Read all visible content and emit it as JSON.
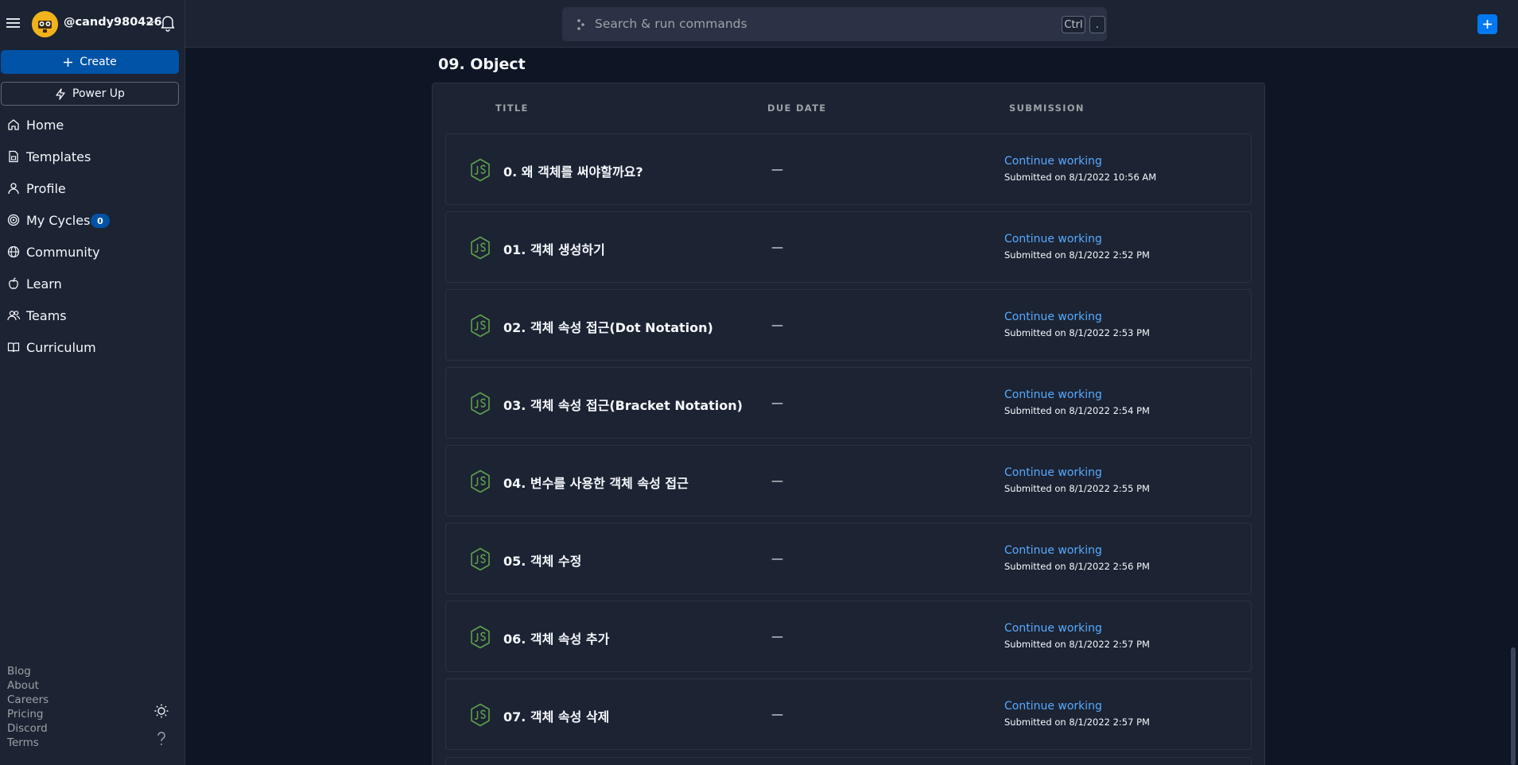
{
  "user": {
    "handle": "@candy980426"
  },
  "sidebar": {
    "create_label": "Create",
    "power_up_label": "Power Up",
    "nav": [
      {
        "label": "Home",
        "icon": "home-icon"
      },
      {
        "label": "Templates",
        "icon": "templates-icon"
      },
      {
        "label": "Profile",
        "icon": "profile-icon"
      },
      {
        "label": "My Cycles",
        "icon": "cycles-icon",
        "badge": "0"
      },
      {
        "label": "Community",
        "icon": "globe-icon"
      },
      {
        "label": "Learn",
        "icon": "learn-icon"
      },
      {
        "label": "Teams",
        "icon": "teams-icon"
      },
      {
        "label": "Curriculum",
        "icon": "book-icon"
      }
    ],
    "footer_links": [
      "Blog",
      "About",
      "Careers",
      "Pricing",
      "Discord",
      "Terms"
    ]
  },
  "topbar": {
    "search_placeholder": "Search & run commands",
    "shortcut_key1": "Ctrl",
    "shortcut_key2": "."
  },
  "section": {
    "title": "09. Object",
    "columns": {
      "title": "TITLE",
      "due": "DUE DATE",
      "submission": "SUBMISSION"
    },
    "rows": [
      {
        "title": "0. 왜 객체를 써야할까요?",
        "due": "—",
        "link": "Continue working",
        "submitted": "Submitted on 8/1/2022 10:56 AM"
      },
      {
        "title": "01. 객체 생성하기",
        "due": "—",
        "link": "Continue working",
        "submitted": "Submitted on 8/1/2022 2:52 PM"
      },
      {
        "title": "02. 객체 속성 접근(Dot Notation)",
        "due": "—",
        "link": "Continue working",
        "submitted": "Submitted on 8/1/2022 2:53 PM"
      },
      {
        "title": "03. 객체 속성 접근(Bracket Notation)",
        "due": "—",
        "link": "Continue working",
        "submitted": "Submitted on 8/1/2022 2:54 PM"
      },
      {
        "title": "04. 변수를 사용한 객체 속성 접근",
        "due": "—",
        "link": "Continue working",
        "submitted": "Submitted on 8/1/2022 2:55 PM"
      },
      {
        "title": "05. 객체 수정",
        "due": "—",
        "link": "Continue working",
        "submitted": "Submitted on 8/1/2022 2:56 PM"
      },
      {
        "title": "06. 객체 속성 추가",
        "due": "—",
        "link": "Continue working",
        "submitted": "Submitted on 8/1/2022 2:57 PM"
      },
      {
        "title": "07. 객체 속성 삭제",
        "due": "—",
        "link": "Continue working",
        "submitted": "Submitted on 8/1/2022 2:57 PM"
      }
    ]
  },
  "colors": {
    "background": "#0e1525",
    "surface": "#1c2333",
    "primary": "#0053a6",
    "link": "#57abff",
    "nodejs_green": "#5fa04e"
  }
}
